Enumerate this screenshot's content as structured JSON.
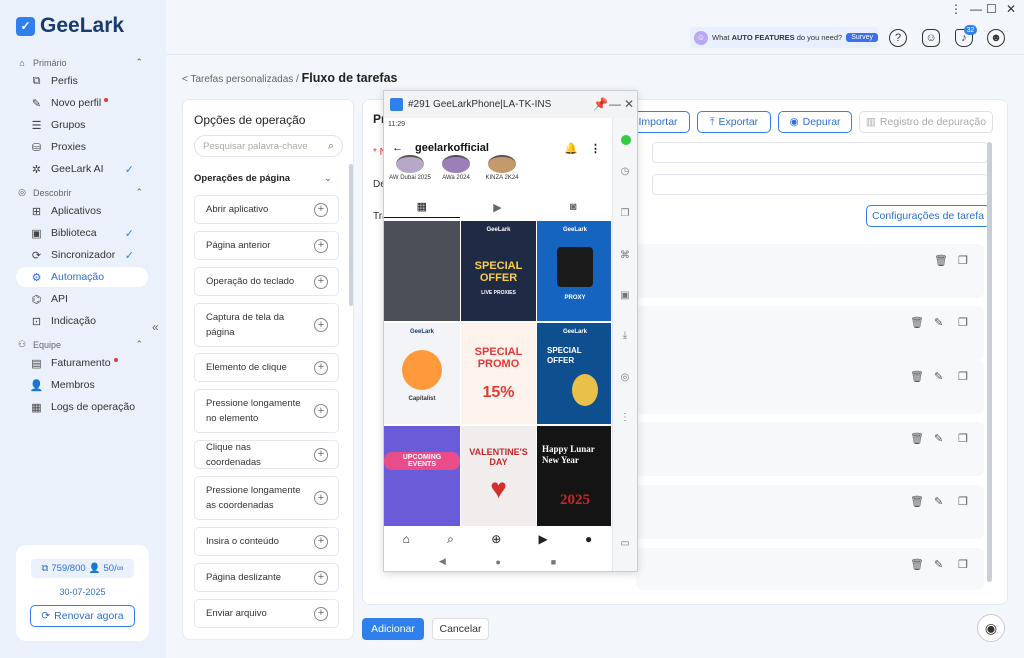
{
  "app": {
    "logo_text": "GeeLark"
  },
  "sidebar": {
    "sections": [
      {
        "label": "Primário",
        "icon": "home-icon",
        "chevron": "⌃"
      },
      {
        "label": "Descobrir",
        "icon": "compass-icon",
        "chevron": "⌃"
      },
      {
        "label": "Equipe",
        "icon": "team-icon",
        "chevron": "⌃"
      }
    ],
    "items": [
      {
        "label": "Perfis",
        "glyph": "⧉"
      },
      {
        "label": "Novo perfil",
        "glyph": "✎"
      },
      {
        "label": "Grupos",
        "glyph": "☰"
      },
      {
        "label": "Proxies",
        "glyph": "⛁"
      },
      {
        "label": "GeeLark AI",
        "glyph": "✲"
      },
      {
        "label": "Aplicativos",
        "glyph": "⊞"
      },
      {
        "label": "Biblioteca",
        "glyph": "▣"
      },
      {
        "label": "Sincronizador",
        "glyph": "⟳"
      },
      {
        "label": "Automação",
        "glyph": "⚙"
      },
      {
        "label": "API",
        "glyph": "⌬"
      },
      {
        "label": "Indicação",
        "glyph": "⊡"
      },
      {
        "label": "Faturamento",
        "glyph": "▤"
      },
      {
        "label": "Membros",
        "glyph": "👤"
      },
      {
        "label": "Logs de operação",
        "glyph": "▦"
      }
    ],
    "collapse": "«",
    "card": {
      "profiles": "759/800",
      "members": "50/∞",
      "date": "30-07-2025",
      "renew_label": "Renovar agora"
    }
  },
  "window_controls": {
    "pin": "⋮",
    "minimize": "—",
    "maximize": "☐",
    "close": "✕"
  },
  "topbar": {
    "banner_prefix": "What ",
    "banner_bold": "AUTO FEATURES",
    "banner_suffix": " do you need?",
    "survey": "Survey",
    "help": "?",
    "notif_count": "32"
  },
  "breadcrumb": {
    "parent": "< Tarefas personalizadas",
    "sep": " / ",
    "current": "Fluxo de tarefas"
  },
  "operations": {
    "title": "Opções de operação",
    "search_placeholder": "Pesquisar palavra-chave",
    "group": "Operações de página",
    "items": [
      "Abrir aplicativo",
      "Página anterior",
      "Operação do teclado",
      "Captura de tela da página",
      "Elemento de clique",
      "Pressione longamente no elemento",
      "Clique nas coordenadas",
      "Pressione longamente as coordenadas",
      "Insira o conteúdo",
      "Página deslizante",
      "Enviar arquivo"
    ]
  },
  "main": {
    "title_partial": "Pr",
    "label_1": "* N",
    "label_2": "De",
    "label_3": "Tra",
    "buttons": {
      "import": "Importar",
      "export": "Exportar",
      "debug": "Depurar",
      "debug_log": "Registro de depuração"
    },
    "config_button": "Configurações de tarefa",
    "add": "Adicionar",
    "cancel": "Cancelar"
  },
  "phone": {
    "title": "#291 GeeLarkPhone|LA-TK-INS",
    "time": "11:29",
    "username": "geelarkofficial",
    "highlights": [
      "AW Dubai 2025",
      "AWa 2024",
      "KINZA 2K24"
    ],
    "posts": [
      {
        "title": "",
        "sub": "",
        "bg": "#4a4f58"
      },
      {
        "title": "SPECIAL OFFER",
        "sub": "LIVE PROXIES",
        "bg": "#1f2a44"
      },
      {
        "title": "",
        "sub": "PROXY",
        "bg": "#1565c0"
      },
      {
        "title": "",
        "sub": "Capitalist",
        "bg": "#f3f4f7"
      },
      {
        "title": "SPECIAL PROMO",
        "sub": "15%",
        "bg": "#fdf3ec"
      },
      {
        "title": "SPECIAL OFFER",
        "sub": "",
        "bg": "#0e4f8f"
      },
      {
        "title": "UPCOMING EVENTS",
        "sub": "",
        "bg": "#6a5cd8"
      },
      {
        "title": "VALENTINE'S DAY",
        "sub": "",
        "bg": "#f1eded"
      },
      {
        "title": "Happy Lunar New Year",
        "sub": "2025",
        "bg": "#141414"
      }
    ]
  },
  "colors": {
    "accent": "#2f80ed",
    "sidebar_bg": "#eaf1fb",
    "page_bg": "#f3f6fb"
  }
}
